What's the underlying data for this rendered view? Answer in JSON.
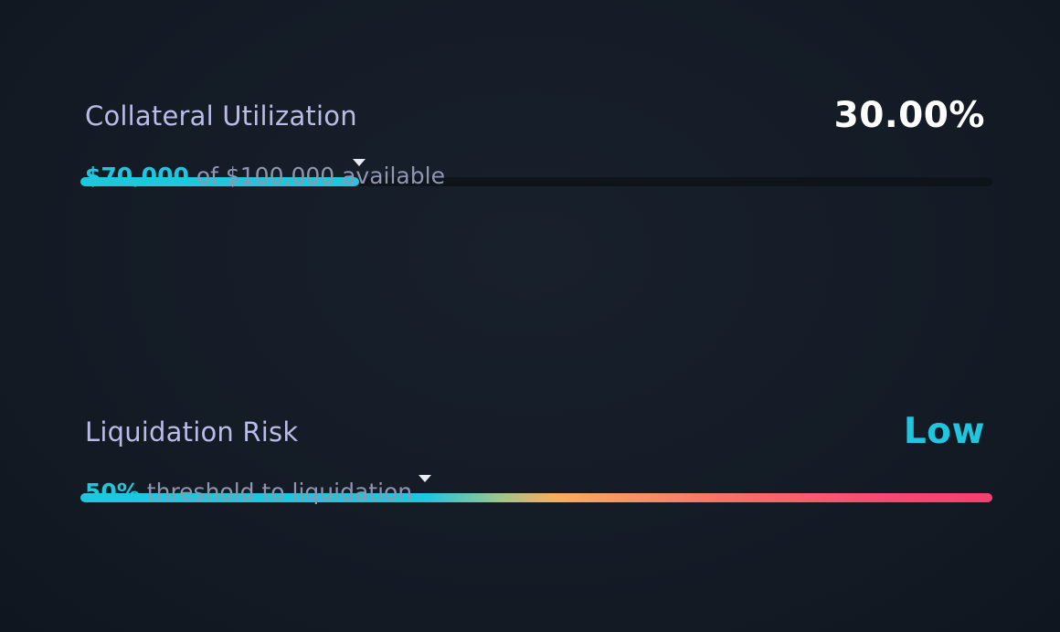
{
  "utilization": {
    "label": "Collateral Utilization",
    "value": "30.00%",
    "fill_fraction": 0.306,
    "marker_fraction": 0.306,
    "amount": "$70,000",
    "caption_rest": "of $100,000 available",
    "accent_color": "#1fc6dd"
  },
  "risk": {
    "label": "Liquidation Risk",
    "value": "Low",
    "marker_fraction": 0.378,
    "threshold": "50%",
    "caption_rest": "threshold to liquidation",
    "gradient_colors": [
      "#1fc6dd",
      "#f9ae5c",
      "#f44a74"
    ]
  }
}
